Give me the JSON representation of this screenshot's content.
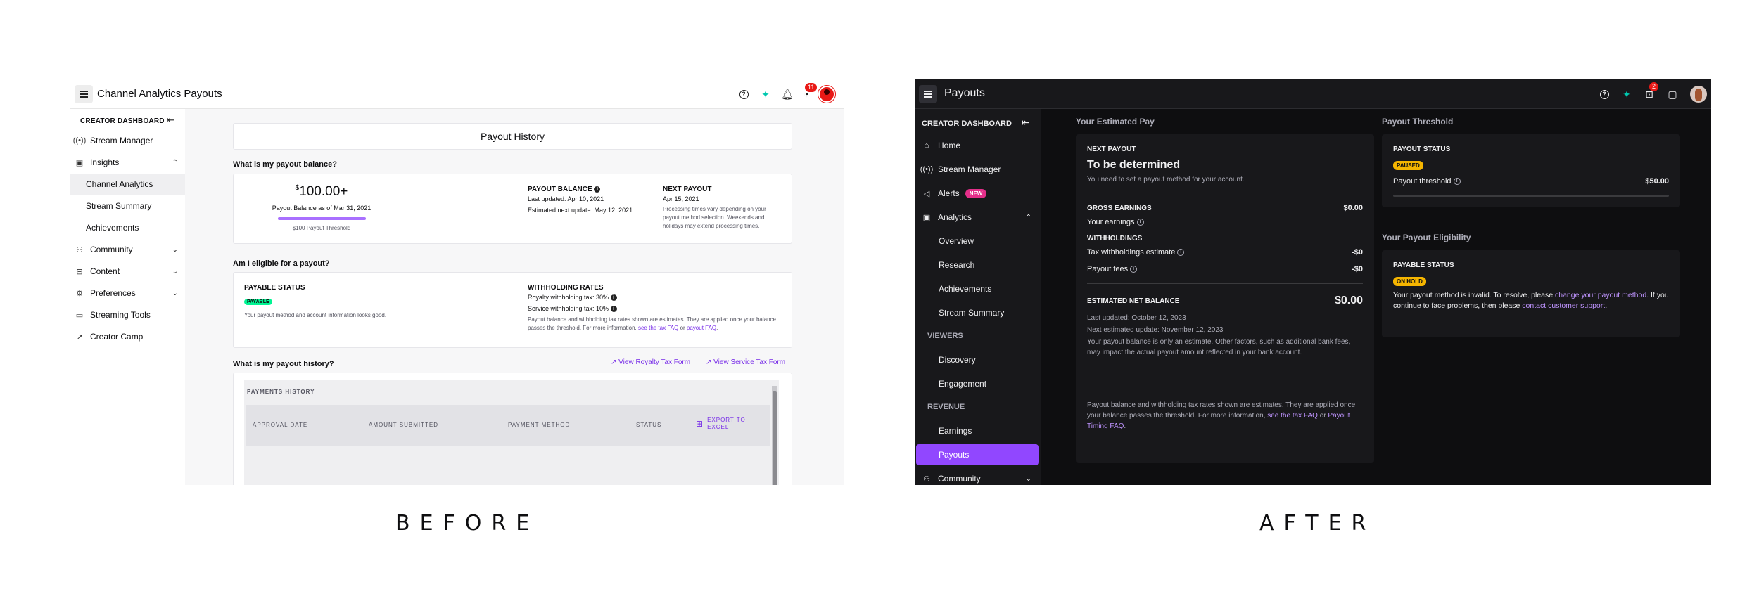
{
  "before": {
    "app_title": "Channel Analytics Payouts",
    "notifications_count": "11",
    "sidebar": {
      "header": "CREATOR DASHBOARD",
      "items": [
        {
          "label": "Stream Manager",
          "icon": "broadcast-icon"
        },
        {
          "label": "Insights",
          "icon": "chart-icon",
          "chevron": "up"
        },
        {
          "label": "Channel Analytics",
          "sub": true,
          "active": true
        },
        {
          "label": "Stream Summary",
          "sub": true
        },
        {
          "label": "Achievements",
          "sub": true
        },
        {
          "label": "Community",
          "icon": "community-icon",
          "chevron": "down"
        },
        {
          "label": "Content",
          "icon": "content-icon",
          "chevron": "down"
        },
        {
          "label": "Preferences",
          "icon": "gear-icon",
          "chevron": "down"
        },
        {
          "label": "Streaming Tools",
          "icon": "camera-icon"
        },
        {
          "label": "Creator Camp",
          "icon": "external-link-icon"
        }
      ]
    },
    "history_title": "Payout History",
    "balance_question": "What is my payout balance?",
    "balance_currency": "$",
    "balance_amount": "100.00+",
    "balance_caption": "Payout Balance as of Mar 31, 2021",
    "balance_threshold": "$100 Payout Threshold",
    "balance_progress": 1.0,
    "payout_balance_label": "PAYOUT BALANCE",
    "payout_balance_updated": "Last updated: Apr 10, 2021",
    "payout_balance_next": "Estimated next update: May 12, 2021",
    "next_payout_label": "NEXT PAYOUT",
    "next_payout_date": "Apr 15, 2021",
    "next_payout_note": "Processing times vary depending on your payout method selection. Weekends and holidays may extend processing times.",
    "eligible_question": "Am I eligible for a payout?",
    "payable_status_label": "PAYABLE STATUS",
    "payable_pill": "PAYABLE",
    "payable_text": "Your payout method and account information looks good.",
    "withholding_label": "WITHHOLDING RATES",
    "royalty_tax": "Royalty withholding tax: 30%",
    "service_tax": "Service withholding tax: 10%",
    "withholding_note": "Payout balance and withholding tax rates shown are estimates. They are applied once your balance passes the threshold. For more information, ",
    "withholding_link1": "see the tax FAQ",
    "withholding_or": " or ",
    "withholding_link2": "payout FAQ",
    "withholding_end": ".",
    "history_question": "What is my payout history?",
    "view_royalty": "View Royalty Tax Form",
    "view_service": "View Service Tax Form",
    "payments_history_label": "PAYMENTS HISTORY",
    "table_headers": [
      "APPROVAL DATE",
      "AMOUNT SUBMITTED",
      "PAYMENT METHOD",
      "STATUS"
    ],
    "export_label": "EXPORT TO EXCEL"
  },
  "after": {
    "app_title": "Payouts",
    "notifications_count": "2",
    "sidebar": {
      "header": "CREATOR DASHBOARD",
      "items": [
        {
          "label": "Home",
          "icon": "home-icon"
        },
        {
          "label": "Stream Manager",
          "icon": "broadcast-icon"
        },
        {
          "label": "Alerts",
          "icon": "megaphone-icon",
          "badge": "NEW"
        },
        {
          "label": "Analytics",
          "icon": "chart-icon",
          "chevron": "up"
        },
        {
          "label": "Overview",
          "sub": true
        },
        {
          "label": "Research",
          "sub": true
        },
        {
          "label": "Achievements",
          "sub": true
        },
        {
          "label": "Stream Summary",
          "sub": true
        }
      ],
      "group_viewers": "VIEWERS",
      "viewer_items": [
        "Discovery",
        "Engagement"
      ],
      "group_revenue": "REVENUE",
      "revenue_items": [
        "Earnings",
        "Payouts"
      ],
      "community": "Community"
    },
    "estimated_heading": "Your Estimated Pay",
    "next_payout_label": "NEXT PAYOUT",
    "next_payout_value": "To be determined",
    "next_payout_note": "You need to set a payout method for your account.",
    "gross_label": "GROSS EARNINGS",
    "gross_value": "$0.00",
    "your_earnings": "Your earnings",
    "withholdings_label": "WITHHOLDINGS",
    "tax_label": "Tax withholdings estimate",
    "tax_value": "-$0",
    "fees_label": "Payout fees",
    "fees_value": "-$0",
    "net_label": "ESTIMATED NET BALANCE",
    "net_value": "$0.00",
    "last_updated": "Last updated: October 12, 2023",
    "next_update": "Next estimated update: November 12, 2023",
    "estimate_note": "Your payout balance is only an estimate. Other factors, such as additional bank fees, may impact the actual payout amount reflected in your bank account.",
    "tax_note": "Payout balance and withholding tax rates shown are estimates. They are applied once your balance passes the threshold. For more information, ",
    "tax_link1": "see the tax FAQ",
    "tax_or": " or ",
    "tax_link2": "Payout Timing FAQ",
    "tax_end": ".",
    "threshold_heading": "Payout Threshold",
    "payout_status_label": "PAYOUT STATUS",
    "paused_pill": "PAUSED",
    "threshold_label": "Payout threshold",
    "threshold_value": "$50.00",
    "eligibility_heading": "Your Payout Eligibility",
    "payable_status_label": "PAYABLE STATUS",
    "onhold_pill": "ON HOLD",
    "invalid_text1": "Your payout method is invalid. To resolve, please ",
    "invalid_link1": "change your payout method",
    "invalid_text2": ". If you continue to face problems, then please ",
    "invalid_link2": "contact customer support",
    "invalid_text3": "."
  },
  "captions": {
    "before": "BEFORE",
    "after": "AFTER"
  }
}
